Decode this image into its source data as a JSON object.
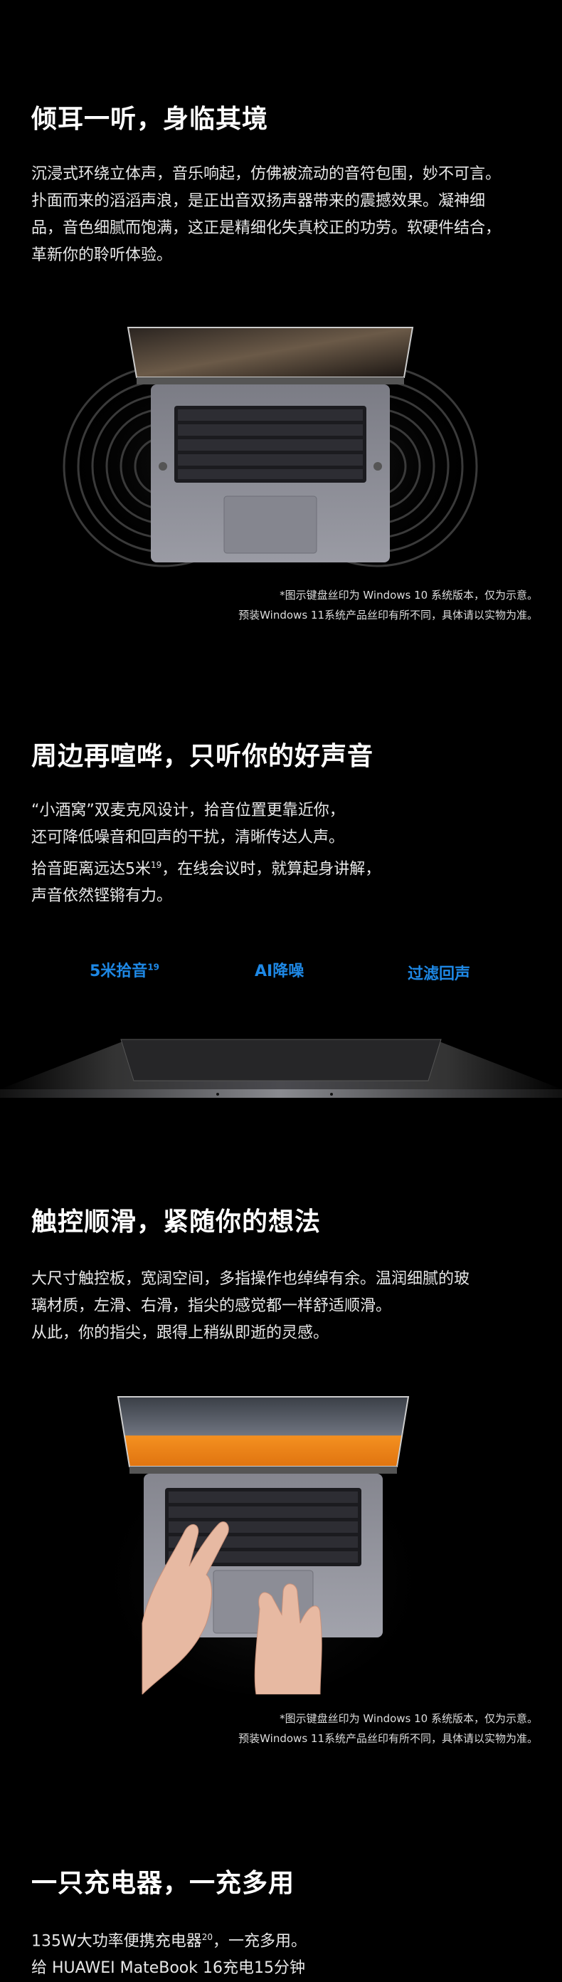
{
  "sections": [
    {
      "title": "倾耳一听，身临其境",
      "lines": [
        "沉浸式环绕立体声，音乐响起，仿佛被流动的音符包围，妙不可言。",
        "扑面而来的滔滔声浪，是正出音双扬声器带来的震撼效果。凝神细",
        "品，音色细腻而饱满，这正是精细化失真校正的功劳。软硬件结合，",
        "革新你的聆听体验。"
      ],
      "note": [
        "*图示键盘丝印为 Windows 10 系统版本，仅为示意。",
        "预装Windows 11系统产品丝印有所不同，具体请以实物为准。"
      ]
    },
    {
      "title": "周边再喧哗，只听你的好声音",
      "lines": [
        "“小酒窝”双麦克风设计，拾音位置更靠近你，",
        "还可降低噪音和回声的干扰，清晰传达人声。",
        "拾音距离远达5米",
        "，在线会议时，就算起身讲解，",
        "声音依然铿锵有力。"
      ],
      "sup": "19",
      "features": [
        {
          "label": "5米拾音",
          "sup": "19"
        },
        {
          "label": "AI降噪"
        },
        {
          "label": "过滤回声"
        }
      ]
    },
    {
      "title": "触控顺滑，紧随你的想法",
      "lines": [
        "大尺寸触控板，宽阔空间，多指操作也绰绰有余。温润细腻的玻",
        "璃材质，左滑、右滑，指尖的感觉都一样舒适顺滑。",
        "从此，你的指尖，跟得上稍纵即逝的灵感。"
      ],
      "note": [
        "*图示键盘丝印为 Windows 10 系统版本，仅为示意。",
        "预装Windows 11系统产品丝印有所不同，具体请以实物为准。"
      ]
    },
    {
      "title": "一只充电器，一充多用",
      "lines": [
        "135W大功率便携充电器",
        "，一充多用。",
        "给 HUAWEI MateBook 16充电15分钟"
      ],
      "sup": "20"
    }
  ],
  "colors": {
    "background": "#000000",
    "accent_blue": "#1e88e5",
    "laptop_silver": "#8e8f97",
    "screen_orange": "#f08a1e"
  }
}
